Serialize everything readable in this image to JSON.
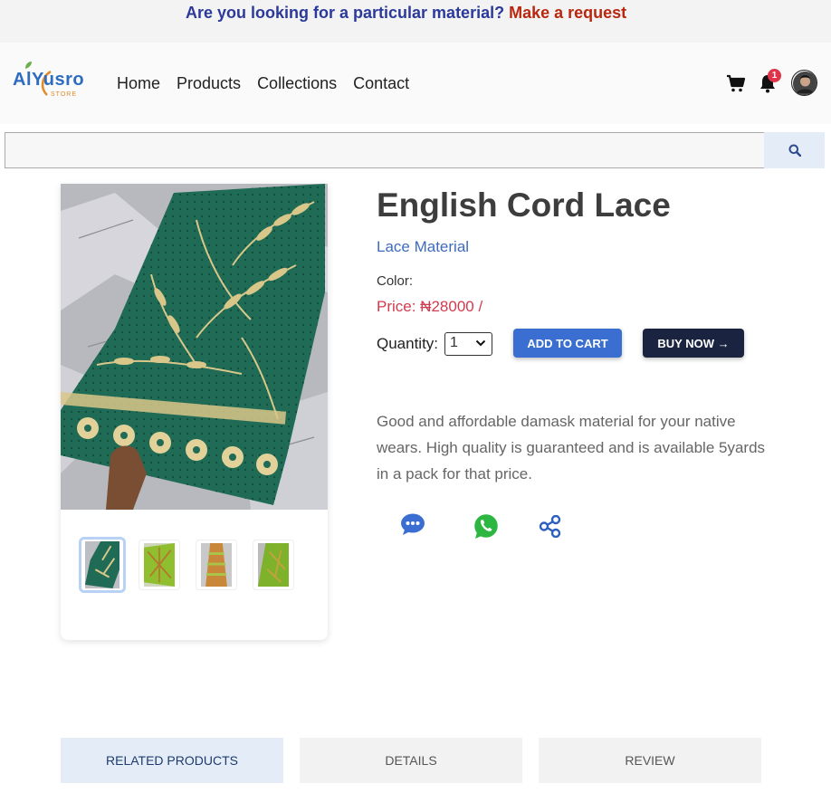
{
  "promo": {
    "question": "Are you looking for a particular material?",
    "link": "Make a request"
  },
  "logo": {
    "name": "AlYusro",
    "tagline": "STORE"
  },
  "nav": {
    "items": [
      {
        "label": "Home"
      },
      {
        "label": "Products"
      },
      {
        "label": "Collections"
      },
      {
        "label": "Contact"
      }
    ]
  },
  "header_icons": {
    "cart": "cart-icon",
    "bell": "bell-icon",
    "notification_count": "1",
    "avatar": "user-avatar"
  },
  "search": {
    "placeholder": "",
    "value": ""
  },
  "product": {
    "title": "English Cord Lace",
    "category": "Lace Material",
    "color_label": "Color:",
    "price": "Price: ₦28000 /",
    "quantity_label": "Quantity:",
    "quantity_value": "1",
    "add_to_cart": "ADD TO CART",
    "buy_now": "BUY NOW →",
    "description": "Good and affordable damask material for your native wears. High quality is guaranteed and is available 5yards in a pack for that price."
  },
  "gallery": {
    "thumbnail_count": 4,
    "selected_index": 0
  },
  "share_icons": [
    "chat-icon",
    "whatsapp-icon",
    "share-icon"
  ],
  "tabs": [
    {
      "label": "RELATED PRODUCTS"
    },
    {
      "label": "DETAILS"
    },
    {
      "label": "REVIEW"
    }
  ],
  "colors": {
    "promo_text": "#2b3a9a",
    "promo_link": "#b8280f",
    "accent_blue": "#3a6fd1",
    "dark_button": "#1a2340",
    "price_red": "#d13b4f",
    "fabric_green": "#1f6b55",
    "fabric_gold": "#d9c78a"
  }
}
